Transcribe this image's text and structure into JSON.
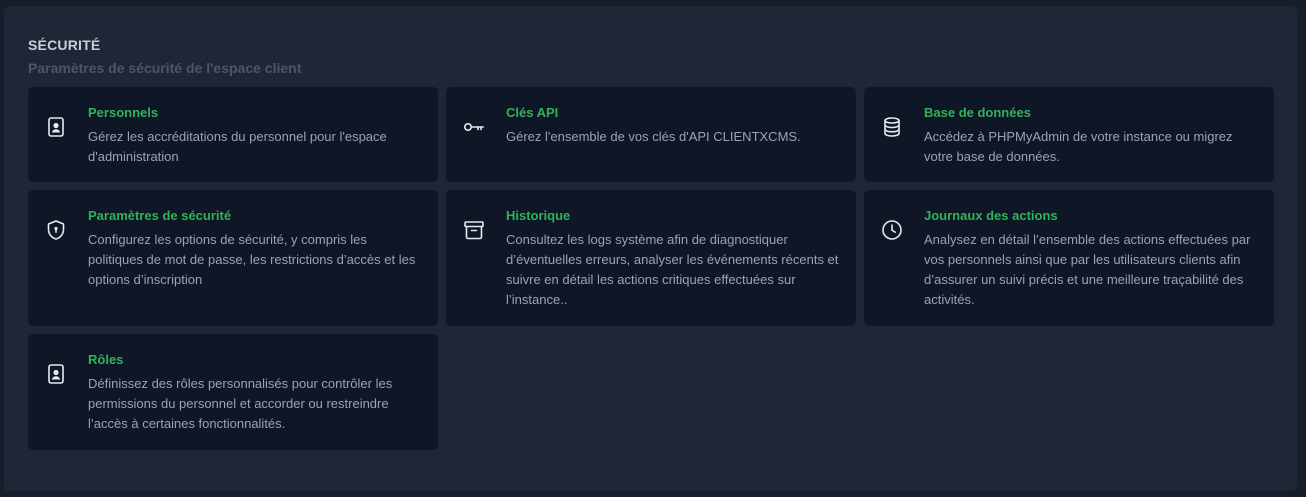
{
  "section": {
    "title": "SÉCURITÉ",
    "subtitle": "Paramètres de sécurité de l'espace client"
  },
  "cards": [
    {
      "title": "Personnels",
      "description": "Gérez les accréditations du personnel pour l'espace d'administration",
      "icon": "id-badge-icon"
    },
    {
      "title": "Clés API",
      "description": "Gérez l'ensemble de vos clés d'API CLIENTXCMS.",
      "icon": "key-icon"
    },
    {
      "title": "Base de données",
      "description": "Accédez à PHPMyAdmin de votre instance ou migrez votre base de données.",
      "icon": "database-icon"
    },
    {
      "title": "Paramètres de sécurité",
      "description": "Configurez les options de sécurité, y compris les politiques de mot de passe, les restrictions d’accès et les options d’inscription",
      "icon": "shield-lock-icon"
    },
    {
      "title": "Historique",
      "description": "Consultez les logs système afin de diagnostiquer d’éventuelles erreurs, analyser les événements récents et suivre en détail les actions critiques effectuées sur l’instance..",
      "icon": "archive-icon"
    },
    {
      "title": "Journaux des actions",
      "description": "Analysez en détail l’ensemble des actions effectuées par vos personnels ainsi que par les utilisateurs clients afin d’assurer un suivi précis et une meilleure traçabilité des activités.",
      "icon": "clock-icon"
    },
    {
      "title": "Rôles",
      "description": "Définissez des rôles personnalisés pour contrôler les permissions du personnel et accorder ou restreindre l’accès à certaines fonctionnalités.",
      "icon": "id-badge-icon"
    }
  ],
  "colors": {
    "accent": "#2fb35a",
    "card_bg": "#0f1626",
    "panel_bg": "#1f2737"
  }
}
